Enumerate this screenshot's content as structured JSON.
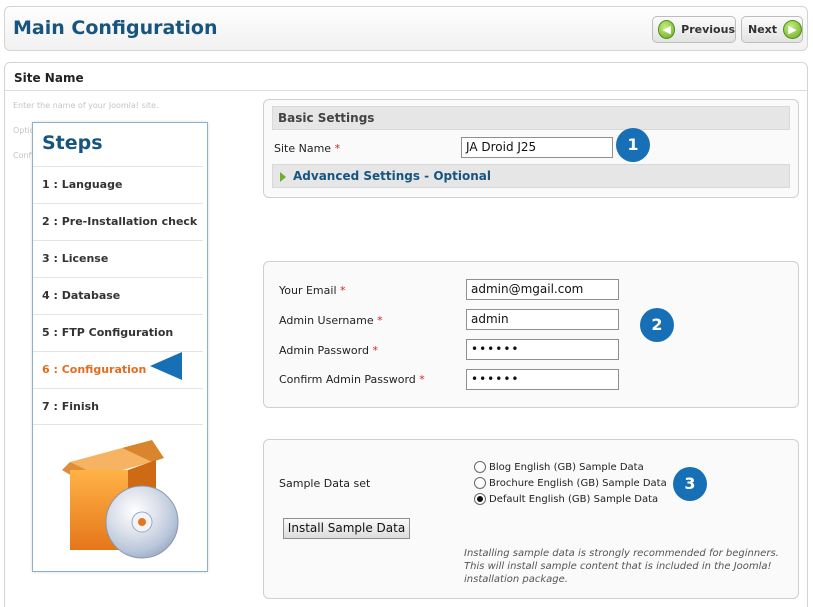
{
  "header": {
    "title": "Main Configuration",
    "previous_label": "Previous",
    "next_label": "Next"
  },
  "panel": {
    "title": "Site Name"
  },
  "help_text": [
    "Enter the name of your Joomla! site.",
    "Optional",
    "Confirm the Admin Email and Password."
  ],
  "steps": {
    "title": "Steps",
    "items": [
      "1 : Language",
      "2 : Pre-Installation check",
      "3 : License",
      "4 : Database",
      "5 : FTP Configuration",
      "6 : Configuration",
      "7 : Finish"
    ],
    "active_index": 5
  },
  "basic": {
    "heading": "Basic Settings",
    "site_name_label": "Site Name",
    "required_mark": "*",
    "site_name_value": "JA Droid J25",
    "advanced_label": "Advanced Settings - Optional",
    "badge": "1"
  },
  "admin": {
    "email_label": "Your Email",
    "email_value": "admin@mgail.com",
    "username_label": "Admin Username",
    "username_value": "admin",
    "password_label": "Admin Password",
    "password_value": "••••••",
    "confirm_label": "Confirm Admin Password",
    "confirm_value": "••••••",
    "badge": "2"
  },
  "sample": {
    "label": "Sample Data set",
    "options": [
      "Blog English (GB) Sample Data",
      "Brochure English (GB) Sample Data",
      "Default English (GB) Sample Data"
    ],
    "selected_index": 2,
    "install_button": "Install Sample Data",
    "note": "Installing sample data is strongly recommended for beginners. This will install sample content that is included in the Joomla! installation package.",
    "badge": "3"
  },
  "colors": {
    "title_blue": "#17557f",
    "badge_blue": "#176fb5",
    "active_step": "#e26d1f",
    "required_red": "#d71f1f",
    "nav_green": "#68aa22"
  }
}
